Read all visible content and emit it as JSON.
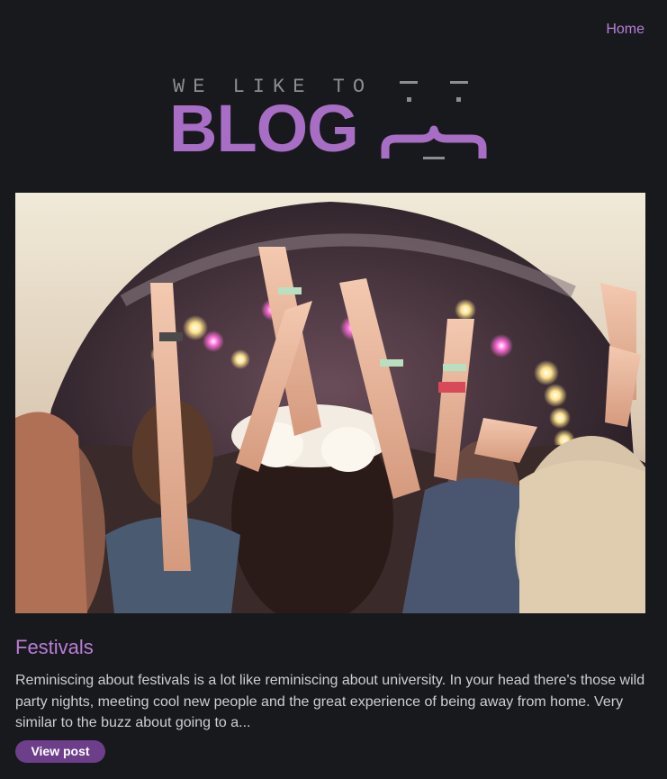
{
  "nav": {
    "home_label": "Home"
  },
  "logo": {
    "tagline": "WE LIKE TO",
    "wordmark": "BLOG",
    "alt": "We Like To Blog logo"
  },
  "post": {
    "image_alt": "Crowd with raised arms at an outdoor festival stage",
    "title": "Festivals",
    "excerpt": "Reminiscing about festivals is a lot like reminiscing about university. In your head there's those wild party nights, meeting cool new people and the great experience of being away from home. Very similar to the buzz about going to a...",
    "button_label": "View post"
  },
  "colors": {
    "background": "#18191c",
    "accent": "#b87fd6",
    "logo_purple": "#a86ec5",
    "button": "#6d3f8b",
    "text": "#cfcfd1"
  }
}
